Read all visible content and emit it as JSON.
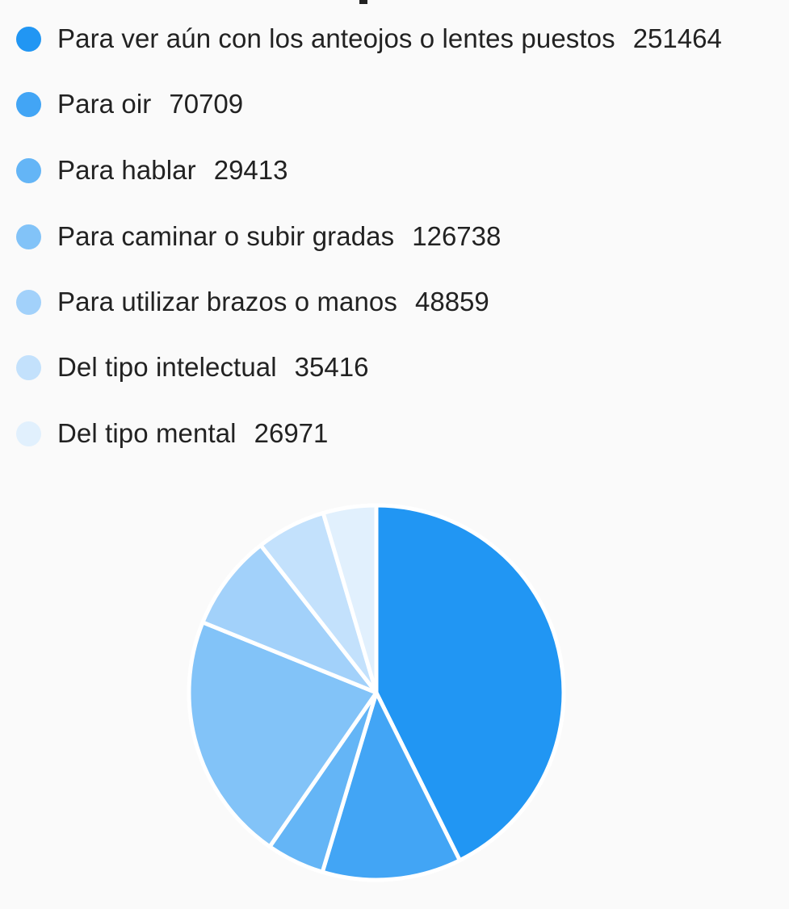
{
  "chart_data": {
    "type": "pie",
    "title": "",
    "legend_position": "top",
    "categories": [
      "Para ver aún con los anteojos o lentes puestos",
      "Para oir",
      "Para hablar",
      "Para caminar o subir gradas",
      "Para utilizar brazos o manos",
      "Del tipo intelectual",
      "Del tipo mental"
    ],
    "values": [
      251464,
      70709,
      29413,
      126738,
      48859,
      35416,
      26971
    ],
    "value_labels": [
      "251464",
      "70709",
      "29413",
      "126738",
      "48859",
      "35416",
      "26971"
    ],
    "colors": [
      "#2196f3",
      "#42a5f5",
      "#64b5f6",
      "#82c3f8",
      "#a2d1fa",
      "#c3e1fc",
      "#e1f0fd"
    ],
    "slice_border_color": "#ffffff"
  }
}
